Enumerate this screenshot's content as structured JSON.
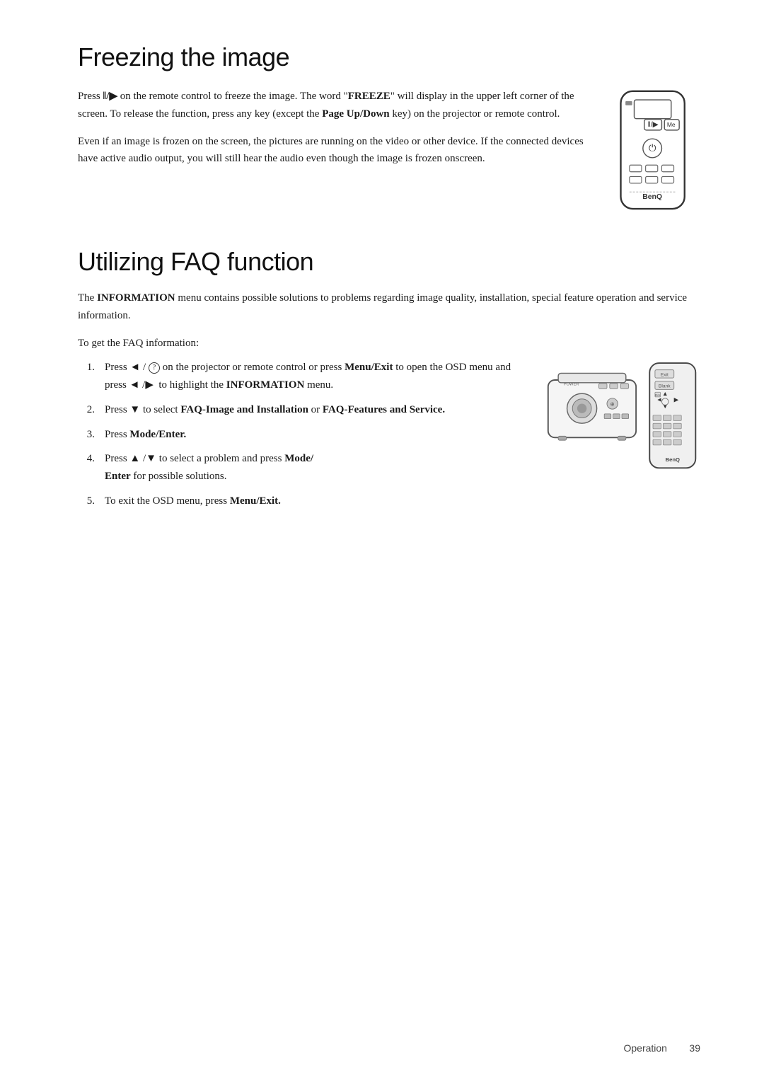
{
  "page": {
    "title_freeze": "Freezing the image",
    "title_faq": "Utilizing FAQ function",
    "freeze_para1": "Press ‖/▶ on the remote control to freeze the image. The word \"FREEZE\" will display in the upper left corner of the screen. To release the function, press any key (except the Page Up/Down key) on the projector or remote control.",
    "freeze_para1_bold1": "FREEZE",
    "freeze_para1_bold2": "Page Up/Down",
    "freeze_para2": "Even if an image is frozen on the screen, the pictures are running on the video or other device. If the connected devices have active audio output, you will still hear the audio even though the image is frozen onscreen.",
    "faq_intro": "The INFORMATION menu contains possible solutions to problems regarding image quality, installation, special feature operation and service information.",
    "faq_intro_bold": "INFORMATION",
    "to_get": "To get the FAQ information:",
    "steps": [
      {
        "num": "1.",
        "text_parts": [
          {
            "text": "Press ◄ / "
          },
          {
            "text": "⊙",
            "circle": true
          },
          {
            "text": " on the projector or remote control or press "
          },
          {
            "text": "Menu/Exit",
            "bold": true
          },
          {
            "text": " to open the OSD menu and press ◄ /▶  to highlight the "
          },
          {
            "text": "INFORMATION",
            "bold": true
          },
          {
            "text": " menu."
          }
        ]
      },
      {
        "num": "2.",
        "text_parts": [
          {
            "text": "Press ▼ to select "
          },
          {
            "text": "FAQ-Image and Installation",
            "bold": true
          },
          {
            "text": " or "
          },
          {
            "text": "FAQ-Features and Service.",
            "bold": true
          }
        ]
      },
      {
        "num": "3.",
        "text_parts": [
          {
            "text": "Press "
          },
          {
            "text": "Mode/Enter.",
            "bold": true
          }
        ]
      },
      {
        "num": "4.",
        "text_parts": [
          {
            "text": "Press ▲ /▼ to select a problem and press "
          },
          {
            "text": "Mode/",
            "bold": true
          },
          {
            "text": "\n"
          },
          {
            "text": "Enter",
            "bold": true
          },
          {
            "text": " for possible solutions."
          }
        ]
      },
      {
        "num": "5.",
        "text_parts": [
          {
            "text": "To exit the OSD menu, press "
          },
          {
            "text": "Menu/Exit.",
            "bold": true
          }
        ]
      }
    ],
    "footer_label": "Operation",
    "footer_page": "39"
  }
}
